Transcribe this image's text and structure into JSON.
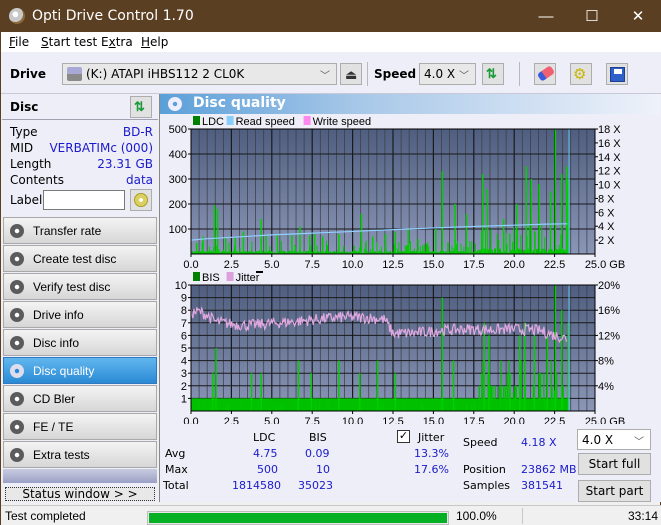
{
  "app": {
    "title": "Opti Drive Control 1.70"
  },
  "window_controls": {
    "minimize": "—",
    "maximize": "☐",
    "close": "✕"
  },
  "menu": [
    {
      "label": "File",
      "accel": "F",
      "rest": "ile"
    },
    {
      "label": "Start test",
      "accel": "S",
      "rest": "tart test"
    },
    {
      "label": "Extra",
      "accel": "x",
      "pre": "E",
      "rest": "tra"
    },
    {
      "label": "Help",
      "accel": "H",
      "rest": "elp"
    }
  ],
  "toolbar": {
    "drive_label": "Drive",
    "drive_value": "(K:)  ATAPI iHBS112  2 CL0K",
    "speed_label": "Speed",
    "speed_value": "4.0 X",
    "icons": [
      "drive-icon",
      "eject-icon",
      "refresh-icon",
      "eraser-icon",
      "settings-icon",
      "save-icon"
    ]
  },
  "disc": {
    "header": "Disc",
    "type_label": "Type",
    "type_value": "BD-R",
    "mid_label": "MID",
    "mid_value": "VERBATIMc (000)",
    "length_label": "Length",
    "length_value": "23.31 GB",
    "contents_label": "Contents",
    "contents_value": "data",
    "label_label": "Label",
    "label_value": ""
  },
  "nav": [
    {
      "label": "Transfer rate",
      "active": false
    },
    {
      "label": "Create test disc",
      "active": false
    },
    {
      "label": "Verify test disc",
      "active": false
    },
    {
      "label": "Drive info",
      "active": false
    },
    {
      "label": "Disc info",
      "active": false
    },
    {
      "label": "Disc quality",
      "active": true
    },
    {
      "label": "CD Bler",
      "active": false
    },
    {
      "label": "FE / TE",
      "active": false
    },
    {
      "label": "Extra tests",
      "active": false
    }
  ],
  "status_window_label": "Status window > >",
  "panel": {
    "title": "Disc quality"
  },
  "chart_data": [
    {
      "type": "bar",
      "title": "LDC / Read speed",
      "legend": [
        "LDC",
        "Read speed",
        "Write speed"
      ],
      "legend_colors": {
        "LDC": "#008000",
        "Read speed": "#87cefa",
        "Write speed": "#ff88ee"
      },
      "legend_position": "top-left",
      "xlabel": "GB",
      "xlim": [
        0,
        25
      ],
      "x_ticks": [
        "0.0",
        "2.5",
        "5.0",
        "7.5",
        "10.0",
        "12.5",
        "15.0",
        "17.5",
        "20.0",
        "22.5",
        "25.0 GB"
      ],
      "ylim": [
        0,
        500
      ],
      "y_ticks": [
        "100",
        "200",
        "300",
        "400",
        "500"
      ],
      "y2lim": [
        0,
        18
      ],
      "y2_ticks": [
        "2 X",
        "4 X",
        "6 X",
        "8 X",
        "10 X",
        "12 X",
        "14 X",
        "16 X",
        "18 X"
      ],
      "grid": true,
      "read_speed": {
        "x": [
          0,
          1,
          2.5,
          4,
          5,
          6.5,
          8,
          9.5,
          11,
          12,
          13,
          14.5,
          16,
          18,
          20,
          22,
          23.3
        ],
        "y": [
          2.0,
          2.2,
          2.4,
          2.6,
          2.75,
          2.9,
          3.05,
          3.2,
          3.35,
          3.45,
          3.55,
          3.7,
          3.85,
          4.0,
          4.15,
          4.3,
          4.35
        ]
      },
      "ldc_peaks": {
        "x": [
          0.3,
          0.7,
          1.4,
          1.6,
          2.1,
          2.7,
          3.2,
          4.3,
          4.6,
          5.3,
          6.2,
          6.7,
          7.3,
          7.6,
          8.1,
          9.1,
          10.5,
          11.2,
          12.0,
          12.6,
          13.4,
          14.0,
          15.1,
          15.5,
          16.3,
          17.0,
          18.0,
          18.3,
          19.3,
          20.1,
          20.7,
          21.0,
          21.5,
          22.2,
          22.5,
          22.9,
          23.2,
          23.3
        ],
        "y": [
          45,
          70,
          195,
          180,
          65,
          70,
          90,
          140,
          75,
          80,
          75,
          110,
          75,
          80,
          70,
          80,
          160,
          70,
          80,
          90,
          100,
          60,
          100,
          330,
          200,
          160,
          320,
          260,
          140,
          200,
          350,
          300,
          280,
          250,
          500,
          320,
          350,
          300
        ]
      },
      "ldc_baseline": 8
    },
    {
      "type": "bar",
      "title": "BIS / Jitter",
      "legend": [
        "BIS",
        "Jitter"
      ],
      "legend_colors": {
        "BIS": "#008000",
        "Jitter": "#dda0dd"
      },
      "legend_position": "top-left",
      "xlabel": "GB",
      "xlim": [
        0,
        25
      ],
      "x_ticks": [
        "0.0",
        "2.5",
        "5.0",
        "7.5",
        "10.0",
        "12.5",
        "15.0",
        "17.5",
        "20.0",
        "22.5",
        "25.0 GB"
      ],
      "ylim": [
        0,
        10
      ],
      "y_ticks": [
        "1",
        "2",
        "3",
        "4",
        "5",
        "6",
        "7",
        "8",
        "9",
        "10"
      ],
      "y2lim": [
        0,
        20
      ],
      "y2_ticks": [
        "4%",
        "8%",
        "12%",
        "16%",
        "20%"
      ],
      "grid": true,
      "jitter_pct": {
        "x": [
          0,
          0.5,
          1.0,
          1.5,
          2.5,
          3.5,
          5.0,
          6.5,
          8.0,
          9.5,
          11.0,
          12.0,
          12.5,
          14.0,
          15.5,
          17.0,
          18.5,
          20.0,
          21.5,
          22.5,
          23.3
        ],
        "y": [
          15.5,
          15.8,
          15.2,
          14.2,
          13.8,
          13.6,
          13.9,
          14.2,
          14.6,
          14.9,
          14.8,
          14.5,
          12.3,
          12.4,
          12.8,
          13.0,
          12.9,
          13.0,
          12.8,
          12.0,
          11.5
        ]
      },
      "bis_peaks": {
        "x": [
          1.3,
          1.5,
          3.7,
          4.3,
          6.6,
          7.4,
          9.1,
          10.4,
          11.5,
          12.6,
          15.5,
          16.2,
          18.1,
          18.4,
          19.7,
          20.3,
          20.6,
          21.2,
          22.0,
          22.5,
          22.9,
          23.3
        ],
        "y": [
          3,
          5,
          3,
          3,
          4,
          3,
          4,
          3,
          4,
          3,
          9,
          4,
          7,
          6,
          3,
          6,
          7,
          6,
          6,
          10,
          8,
          7
        ]
      },
      "bis_baseline": 1
    }
  ],
  "stats": {
    "col_ldc": "LDC",
    "col_bis": "BIS",
    "jitter_label": "Jitter",
    "jitter_checked": true,
    "rows": [
      {
        "label": "Avg",
        "ldc": "4.75",
        "bis": "0.09",
        "jitter": "13.3%"
      },
      {
        "label": "Max",
        "ldc": "500",
        "bis": "10",
        "jitter": "17.6%"
      },
      {
        "label": "Total",
        "ldc": "1814580",
        "bis": "35023",
        "jitter": ""
      }
    ],
    "speed_label": "Speed",
    "speed_value": "4.18 X",
    "position_label": "Position",
    "position_value": "23862 MB",
    "samples_label": "Samples",
    "samples_value": "381541",
    "speed_select": "4.0 X",
    "start_full": "Start full",
    "start_part": "Start part"
  },
  "statusbar": {
    "text": "Test completed",
    "progress": 1.0,
    "progress_text": "100.0%",
    "time": "33:14"
  }
}
